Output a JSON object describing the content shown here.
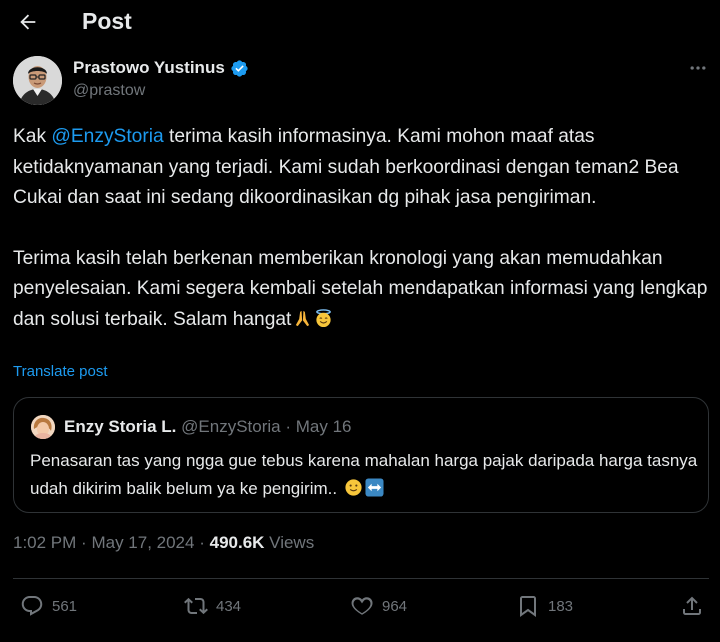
{
  "header": {
    "title": "Post"
  },
  "author": {
    "name": "Prastowo Yustinus",
    "handle": "@prastow",
    "verified": true
  },
  "tweet": {
    "p1_before_mention": "Kak ",
    "mention": "@EnzyStoria",
    "p1_after_mention": " terima kasih informasinya. Kami mohon maaf atas ketidaknyamanan yang terjadi. Kami sudah berkoordinasi dengan teman2 Bea Cukai dan saat ini sedang dikoordinasikan dg pihak jasa pengiriman.",
    "p2": "Terima kasih telah berkenan memberikan kronologi yang akan memudahkan penyelesaian. Kami segera kembali setelah mendapatkan informasi yang lengkap dan solusi terbaik. Salam hangat",
    "p2_emojis": [
      "folded-hands",
      "smiling-face-with-halo"
    ],
    "translate_label": "Translate post"
  },
  "quoted": {
    "name": "Enzy Storia L.",
    "handle": "@EnzyStoria",
    "separator": "·",
    "date": "May 16",
    "text": "Penasaran tas yang ngga gue tebus karena mahalan harga pajak daripada harga tasnya udah dikirim balik belum ya ke pengirim..",
    "emojis": [
      "slightly-smiling-face",
      "left-right-arrow"
    ]
  },
  "meta": {
    "time": "1:02 PM",
    "separator": "·",
    "date": "May 17, 2024",
    "views_count": "490.6K",
    "views_label": "Views"
  },
  "actions": {
    "replies": "561",
    "reposts": "434",
    "likes": "964",
    "bookmarks": "183"
  },
  "colors": {
    "background": "#000000",
    "text": "#e7e9ea",
    "muted": "#71767b",
    "accent": "#1d9bf0",
    "border": "#2f3336"
  }
}
